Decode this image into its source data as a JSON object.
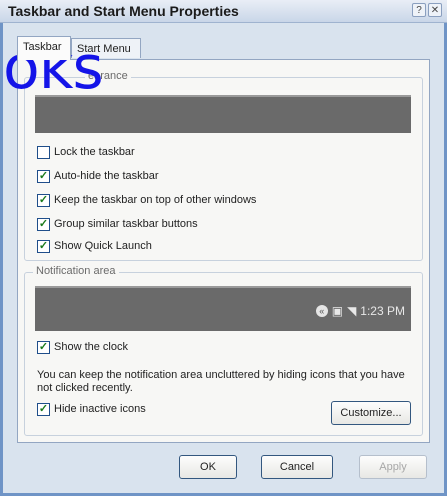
{
  "window": {
    "title": "Taskbar and Start Menu Properties"
  },
  "titlebar_buttons": {
    "help": "?",
    "close": "✕"
  },
  "tabs": [
    {
      "label": "Taskbar",
      "active": true
    },
    {
      "label": "Start Menu",
      "active": false
    }
  ],
  "overlay_text": "oks",
  "appearance": {
    "legend": "earance",
    "options": [
      {
        "label": "Lock the taskbar",
        "checked": false
      },
      {
        "label": "Auto-hide the taskbar",
        "checked": true
      },
      {
        "label": "Keep the taskbar on top of other windows",
        "checked": true
      },
      {
        "label": "Group similar taskbar buttons",
        "checked": true
      },
      {
        "label": "Show Quick Launch",
        "checked": true
      }
    ]
  },
  "notification": {
    "legend": "Notification area",
    "clock_time": "1:23 PM",
    "show_clock": {
      "label": "Show the clock",
      "checked": true
    },
    "note": "You can keep the notification area uncluttered by hiding icons that you have not clicked recently.",
    "hide_inactive": {
      "label": "Hide inactive icons",
      "checked": true
    },
    "customize_label": "Customize..."
  },
  "buttons": {
    "ok": "OK",
    "cancel": "Cancel",
    "apply": "Apply"
  },
  "colors": {
    "accent": "#6f94c6",
    "overlay": "#1414e8"
  }
}
